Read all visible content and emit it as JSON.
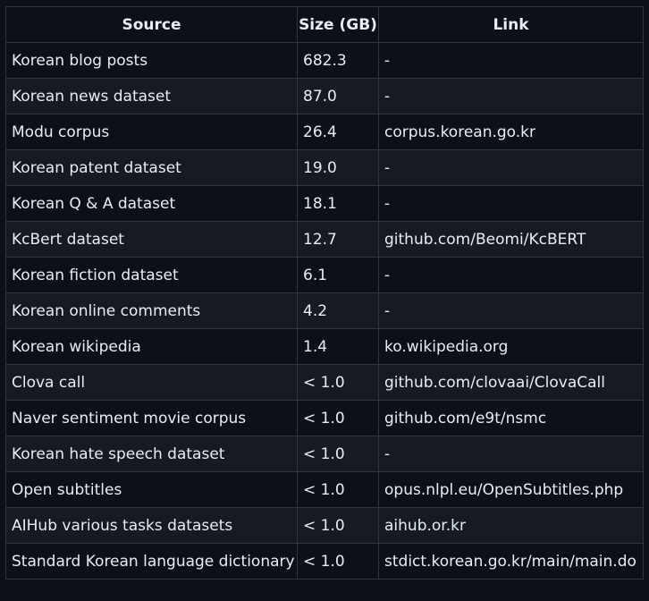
{
  "table": {
    "headers": [
      "Source",
      "Size (GB)",
      "Link"
    ],
    "rows": [
      {
        "source": "Korean blog posts",
        "size": "682.3",
        "link": "-"
      },
      {
        "source": "Korean news dataset",
        "size": "87.0",
        "link": "-"
      },
      {
        "source": "Modu corpus",
        "size": "26.4",
        "link": "corpus.korean.go.kr"
      },
      {
        "source": "Korean patent dataset",
        "size": "19.0",
        "link": "-"
      },
      {
        "source": "Korean Q & A dataset",
        "size": "18.1",
        "link": "-"
      },
      {
        "source": "KcBert dataset",
        "size": "12.7",
        "link": "github.com/Beomi/KcBERT"
      },
      {
        "source": "Korean fiction dataset",
        "size": "6.1",
        "link": "-"
      },
      {
        "source": "Korean online comments",
        "size": "4.2",
        "link": "-"
      },
      {
        "source": "Korean wikipedia",
        "size": "1.4",
        "link": "ko.wikipedia.org"
      },
      {
        "source": "Clova call",
        "size": "< 1.0",
        "link": "github.com/clovaai/ClovaCall"
      },
      {
        "source": "Naver sentiment movie corpus",
        "size": "< 1.0",
        "link": "github.com/e9t/nsmc"
      },
      {
        "source": "Korean hate speech dataset",
        "size": "< 1.0",
        "link": "-"
      },
      {
        "source": "Open subtitles",
        "size": "< 1.0",
        "link": "opus.nlpl.eu/OpenSubtitles.php"
      },
      {
        "source": "AIHub various tasks datasets",
        "size": "< 1.0",
        "link": "aihub.or.kr"
      },
      {
        "source": "Standard Korean language dictionary",
        "size": "< 1.0",
        "link": "stdict.korean.go.kr/main/main.do"
      }
    ]
  },
  "colors": {
    "background": "#0d1117",
    "row_alt": "#161b22",
    "border": "#30363d",
    "text": "#e6edf3"
  }
}
